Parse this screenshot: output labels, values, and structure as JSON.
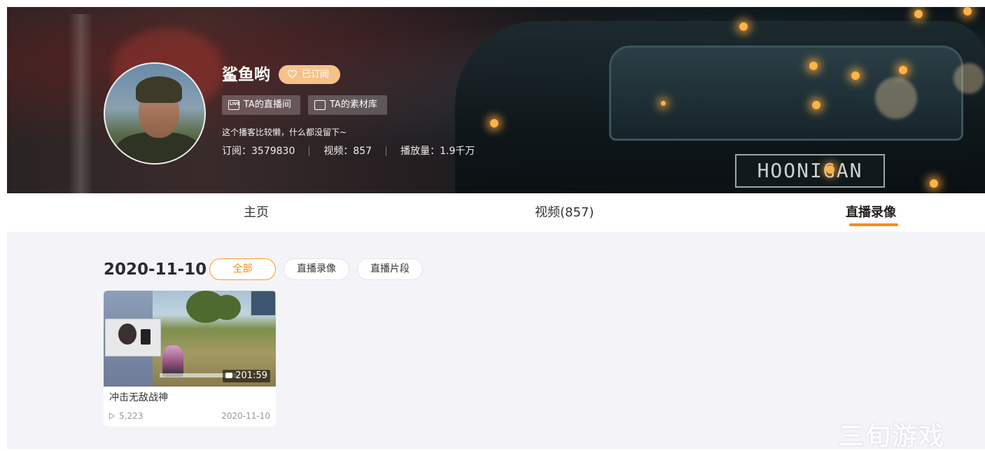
{
  "profile": {
    "name": "鲨鱼哟",
    "subscribe_label": "已订阅",
    "live_room_label": "TA的直播间",
    "material_label": "TA的素材库",
    "live_icon_text": "LIVE",
    "bio": "这个播客比较懒，什么都没留下~",
    "stats": [
      {
        "label": "订阅：",
        "value": "3579830"
      },
      {
        "label": "视频：",
        "value": "857"
      },
      {
        "label": "播放量：",
        "value": "1.9千万"
      }
    ],
    "banner_plate": "HOONIGAN"
  },
  "tabs": [
    {
      "label": "主页"
    },
    {
      "label": "视频(857)"
    },
    {
      "label": "直播录像"
    }
  ],
  "content": {
    "date": "2020-11-10",
    "filters": [
      {
        "label": "全部"
      },
      {
        "label": "直播录像"
      },
      {
        "label": "直播片段"
      }
    ],
    "videos": [
      {
        "title": "冲击无敌战神",
        "duration": "201:59",
        "views": "5,223",
        "date": "2020-11-10"
      }
    ]
  },
  "watermark": "三旬游戏",
  "colors": {
    "accent": "#ff8a00",
    "subscribed_bg": "#f7c28a",
    "content_bg": "#f4f4f8"
  }
}
